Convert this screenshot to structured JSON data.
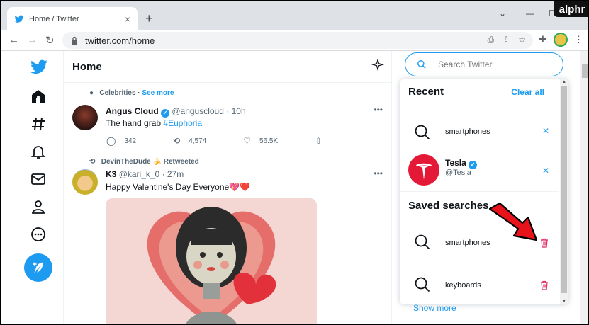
{
  "browser": {
    "tab_title": "Home / Twitter",
    "tab_close": "×",
    "new_tab": "+",
    "url": "twitter.com/home",
    "watermark": "alphr"
  },
  "colors": {
    "accent": "#1d9bf0",
    "red": "#e0245e"
  },
  "main": {
    "header": "Home",
    "tweets": [
      {
        "context_prefix": "Celebrities",
        "context_sep": " · ",
        "context_link": "See more",
        "name": "Angus Cloud",
        "handle": "@anguscloud",
        "time": "· 10h",
        "text_plain": "The hand grab ",
        "text_hashtag": "#Euphoria",
        "replies": "342",
        "retweets": "4,574",
        "likes": "56.5K"
      },
      {
        "context_prefix": "DevinTheDude",
        "context_suffix": "Retweeted",
        "name": "K3",
        "handle": "@kari_k_0",
        "time": "· 27m",
        "text": "Happy Valentine's Day Everyone💖❤️"
      }
    ]
  },
  "search": {
    "placeholder": "Search Twitter",
    "recent_title": "Recent",
    "clear_all": "Clear all",
    "recent": [
      {
        "label": "smartphones"
      },
      {
        "name": "Tesla",
        "handle": "@Tesla"
      }
    ],
    "saved_title": "Saved searches",
    "saved": [
      {
        "label": "smartphones"
      },
      {
        "label": "keyboards"
      }
    ],
    "show_more": "Show more"
  }
}
